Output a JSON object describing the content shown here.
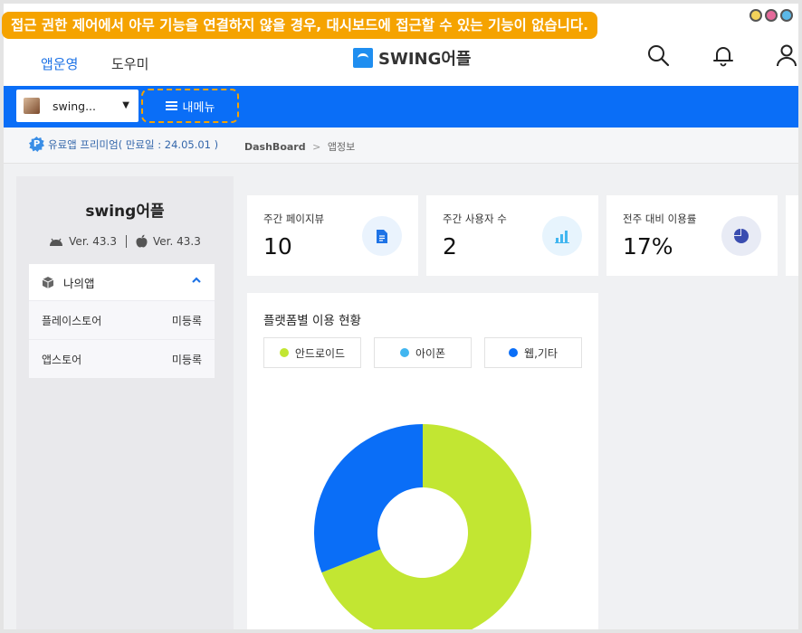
{
  "banner": "접근 권한 제어에서 아무 기능을 연결하지 않을 경우, 대시보드에 접근할 수 있는 기능이 없습니다.",
  "window_controls": {
    "colors": [
      "#f3d25a",
      "#e56a9a",
      "#5bb8e8"
    ]
  },
  "topnav": {
    "tabs": [
      {
        "label": "앱운영"
      },
      {
        "label": "도우미"
      }
    ],
    "brand": "SWING어플",
    "icons": [
      "search-icon",
      "bell-icon",
      "user-icon"
    ]
  },
  "bluebar": {
    "app_select": "swing...",
    "menu_button": "내메뉴"
  },
  "crumbbar": {
    "premium_badge": "P",
    "premium": "유료앱 프리미엄( 만료일 : 24.05.01 )",
    "crumb_root": "DashBoard",
    "crumb_sep": ">",
    "crumb_current": "앱정보"
  },
  "app_panel": {
    "title": "swing어플",
    "android_version": "Ver. 43.3",
    "ios_version": "Ver. 43.3",
    "my_apps": "나의앱",
    "stores": [
      {
        "name": "플레이스토어",
        "status": "미등록"
      },
      {
        "name": "앱스토어",
        "status": "미등록"
      }
    ]
  },
  "stats": [
    {
      "label": "주간 페이지뷰",
      "value": "10",
      "icon": "document-icon"
    },
    {
      "label": "주간 사용자 수",
      "value": "2",
      "icon": "bar-chart-icon"
    },
    {
      "label": "전주 대비 이용률",
      "value": "17%",
      "icon": "pie-chart-icon"
    }
  ],
  "chart_data": {
    "type": "pie",
    "title": "플랫폼별 이용 현황",
    "categories": [
      "안드로이드",
      "아이폰",
      "웹,기타"
    ],
    "values": [
      69,
      0,
      31
    ],
    "colors": [
      "#c2e632",
      "#41b6f0",
      "#0a6ef7"
    ]
  }
}
